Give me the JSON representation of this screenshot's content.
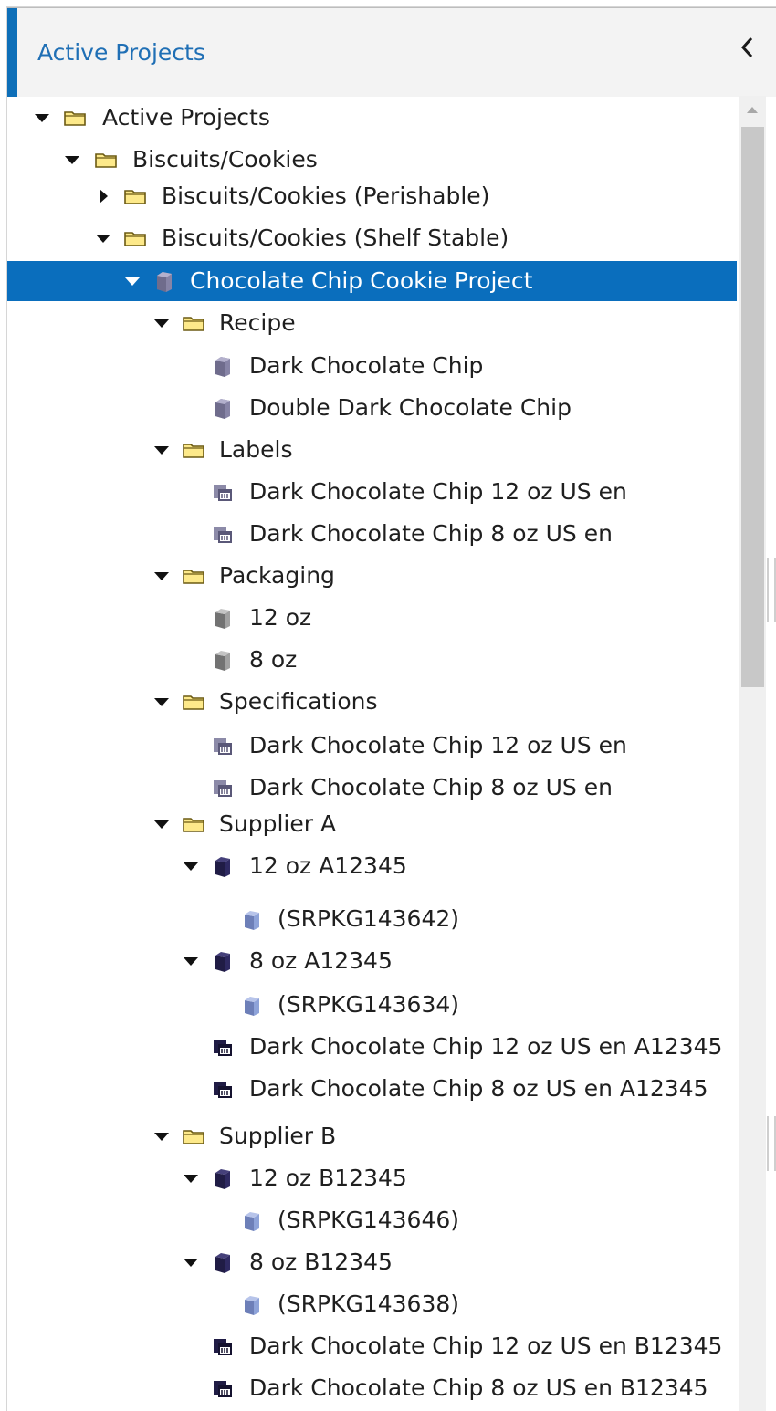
{
  "colors": {
    "accent": "#0e6fb8",
    "header_text": "#1f6fb5",
    "selection_bg": "#0a6ebd",
    "folder_fill": "#fde98a",
    "folder_stroke": "#6b5a13",
    "item_gray": "#8a8a8a",
    "item_purple": "#8784a6",
    "item_navy": "#201c45",
    "item_blue": "#8ea3d9"
  },
  "header": {
    "title": "Active Projects",
    "collapse_icon": "chevron-left-icon"
  },
  "tree": [
    {
      "label": "Active Projects",
      "level": 0,
      "toggle": "expanded",
      "icon": "folder-icon",
      "selected": false
    },
    {
      "label": "Biscuits/Cookies",
      "level": 1,
      "toggle": "expanded",
      "icon": "folder-icon",
      "selected": false
    },
    {
      "label": "Biscuits/Cookies (Perishable)",
      "level": 2,
      "toggle": "collapsed",
      "icon": "folder-icon",
      "selected": false
    },
    {
      "label": "Biscuits/Cookies (Shelf Stable)",
      "level": 2,
      "toggle": "expanded",
      "icon": "folder-icon",
      "selected": false
    },
    {
      "label": "Chocolate Chip Cookie Project",
      "level": 3,
      "toggle": "expanded",
      "icon": "project-cube-icon",
      "selected": true
    },
    {
      "label": "Recipe",
      "level": 4,
      "toggle": "expanded",
      "icon": "folder-icon",
      "selected": false
    },
    {
      "label": "Dark Chocolate Chip",
      "level": 5,
      "toggle": "none",
      "icon": "recipe-cube-icon",
      "selected": false
    },
    {
      "label": "Double Dark Chocolate Chip",
      "level": 5,
      "toggle": "none",
      "icon": "recipe-cube-icon",
      "selected": false
    },
    {
      "label": "Labels",
      "level": 4,
      "toggle": "expanded",
      "icon": "folder-icon",
      "selected": false
    },
    {
      "label": "Dark Chocolate Chip 12 oz US en",
      "level": 5,
      "toggle": "none",
      "icon": "label-doc-icon",
      "selected": false
    },
    {
      "label": "Dark Chocolate Chip 8 oz US en",
      "level": 5,
      "toggle": "none",
      "icon": "label-doc-icon",
      "selected": false
    },
    {
      "label": "Packaging",
      "level": 4,
      "toggle": "expanded",
      "icon": "folder-icon",
      "selected": false
    },
    {
      "label": "12 oz",
      "level": 5,
      "toggle": "none",
      "icon": "package-cube-icon",
      "selected": false
    },
    {
      "label": "8 oz",
      "level": 5,
      "toggle": "none",
      "icon": "package-cube-icon",
      "selected": false
    },
    {
      "label": "Specifications",
      "level": 4,
      "toggle": "expanded",
      "icon": "folder-icon",
      "selected": false
    },
    {
      "label": "Dark Chocolate Chip 12 oz US en",
      "level": 5,
      "toggle": "none",
      "icon": "spec-doc-icon",
      "selected": false
    },
    {
      "label": "Dark Chocolate Chip 8 oz US en",
      "level": 5,
      "toggle": "none",
      "icon": "spec-doc-icon",
      "selected": false
    },
    {
      "label": "Supplier A",
      "level": 4,
      "toggle": "expanded",
      "icon": "folder-icon",
      "selected": false
    },
    {
      "label": "12 oz A12345",
      "level": 5,
      "toggle": "expanded",
      "icon": "supplier-cube-icon",
      "selected": false
    },
    {
      "label": "(SRPKG143642)",
      "level": 6,
      "toggle": "none",
      "icon": "sr-package-cube-icon",
      "selected": false
    },
    {
      "label": "8 oz A12345",
      "level": 5,
      "toggle": "expanded",
      "icon": "supplier-cube-icon",
      "selected": false
    },
    {
      "label": "(SRPKG143634)",
      "level": 6,
      "toggle": "none",
      "icon": "sr-package-cube-icon",
      "selected": false
    },
    {
      "label": "Dark Chocolate Chip 12 oz US en A12345",
      "level": 5,
      "toggle": "none",
      "icon": "supplier-spec-doc-icon",
      "selected": false
    },
    {
      "label": "Dark Chocolate Chip 8 oz US en A12345",
      "level": 5,
      "toggle": "none",
      "icon": "supplier-spec-doc-icon",
      "selected": false
    },
    {
      "label": "Supplier B",
      "level": 4,
      "toggle": "expanded",
      "icon": "folder-icon",
      "selected": false
    },
    {
      "label": "12 oz B12345",
      "level": 5,
      "toggle": "expanded",
      "icon": "supplier-cube-icon",
      "selected": false
    },
    {
      "label": "(SRPKG143646)",
      "level": 6,
      "toggle": "none",
      "icon": "sr-package-cube-icon",
      "selected": false
    },
    {
      "label": "8 oz B12345",
      "level": 5,
      "toggle": "expanded",
      "icon": "supplier-cube-icon",
      "selected": false
    },
    {
      "label": "(SRPKG143638)",
      "level": 6,
      "toggle": "none",
      "icon": "sr-package-cube-icon",
      "selected": false
    },
    {
      "label": "Dark Chocolate Chip 12 oz US en B12345",
      "level": 5,
      "toggle": "none",
      "icon": "supplier-spec-doc-icon",
      "selected": false
    },
    {
      "label": "Dark Chocolate Chip 8 oz US en B12345",
      "level": 5,
      "toggle": "none",
      "icon": "supplier-spec-doc-icon",
      "selected": false
    }
  ]
}
